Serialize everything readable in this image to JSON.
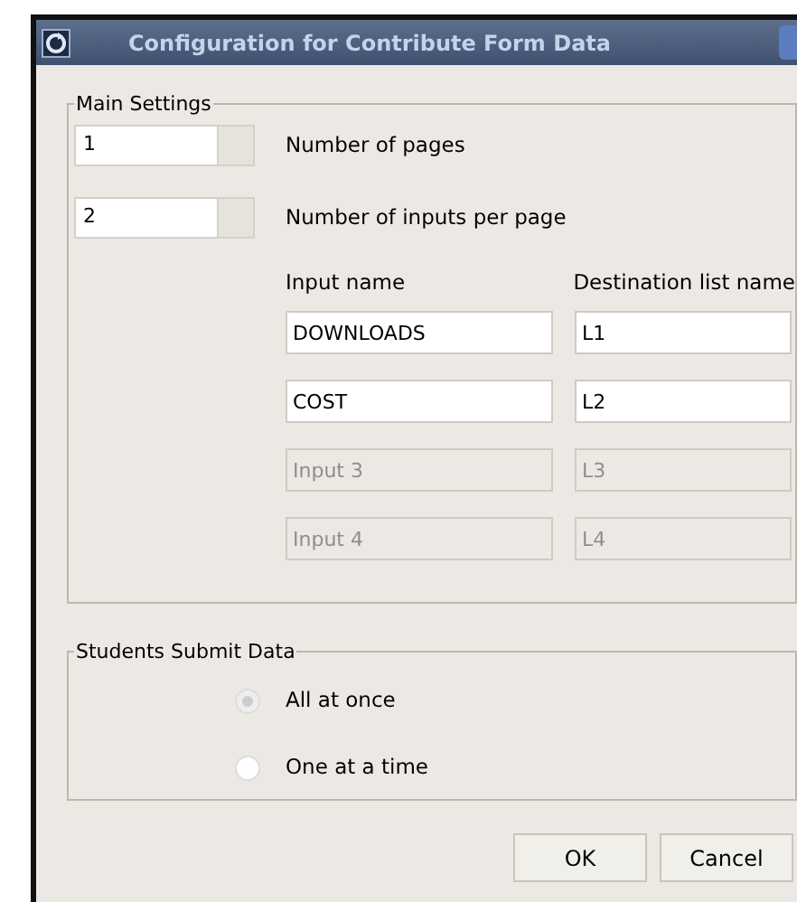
{
  "window": {
    "title": "Configuration for Contribute Form Data"
  },
  "main_settings": {
    "legend": "Main Settings",
    "spinners": [
      {
        "value": "1",
        "label": "Number of pages"
      },
      {
        "value": "2",
        "label": "Number of inputs per page"
      }
    ],
    "columns": [
      "Input name",
      "Destination list name"
    ],
    "rows": [
      {
        "input": "DOWNLOADS",
        "destination": "L1",
        "disabled": false
      },
      {
        "input": "COST",
        "destination": "L2",
        "disabled": false
      },
      {
        "input": "Input 3",
        "destination": "L3",
        "disabled": true
      },
      {
        "input": "Input 4",
        "destination": "L4",
        "disabled": true
      }
    ]
  },
  "submit": {
    "legend": "Students Submit Data",
    "options": [
      {
        "label": "All at once",
        "selected": true
      },
      {
        "label": "One at a time",
        "selected": false
      }
    ]
  },
  "buttons": [
    "OK",
    "Cancel"
  ]
}
